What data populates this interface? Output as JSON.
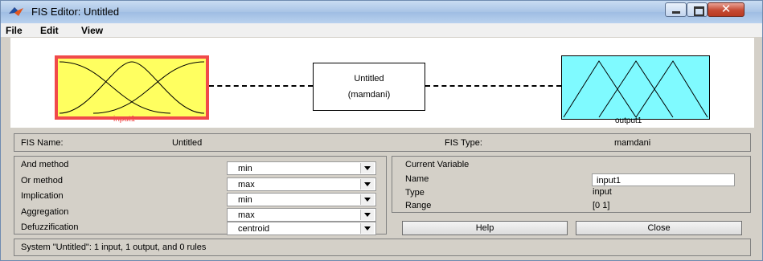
{
  "window": {
    "title": "FIS Editor: Untitled"
  },
  "menu": [
    "File",
    "Edit",
    "View"
  ],
  "diagram": {
    "input_label": "input1",
    "output_label": "output1",
    "system_name": "Untitled",
    "system_type": "(mamdani)"
  },
  "info": {
    "fis_name_label": "FIS Name:",
    "fis_name_value": "Untitled",
    "fis_type_label": "FIS Type:",
    "fis_type_value": "mamdani"
  },
  "methods": [
    {
      "label": "And method",
      "value": "min"
    },
    {
      "label": "Or method",
      "value": "max"
    },
    {
      "label": "Implication",
      "value": "min"
    },
    {
      "label": "Aggregation",
      "value": "max"
    },
    {
      "label": "Defuzzification",
      "value": "centroid"
    }
  ],
  "current_variable": {
    "header": "Current Variable",
    "name_label": "Name",
    "name_value": "input1",
    "type_label": "Type",
    "type_value": "input",
    "range_label": "Range",
    "range_value": "[0 1]"
  },
  "buttons": {
    "help": "Help",
    "close": "Close"
  },
  "status": "System \"Untitled\": 1 input, 1 output, and 0 rules",
  "colors": {
    "input_fill": "#ffff60",
    "input_border": "#f04a4a",
    "output_fill": "#7ffaff"
  }
}
